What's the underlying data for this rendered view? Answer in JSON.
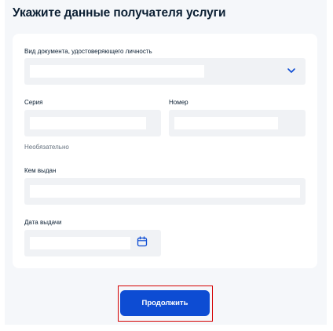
{
  "page": {
    "title": "Укажите данные получателя услуги"
  },
  "form": {
    "document_type": {
      "label": "Вид документа, удостоверяющего личность",
      "value": ""
    },
    "series": {
      "label": "Серия",
      "value": "",
      "hint": "Необязательно"
    },
    "number": {
      "label": "Номер",
      "value": ""
    },
    "issued_by": {
      "label": "Кем выдан",
      "value": ""
    },
    "issue_date": {
      "label": "Дата выдачи",
      "value": ""
    }
  },
  "actions": {
    "continue_label": "Продолжить"
  },
  "icons": {
    "select": "chevron-down-icon",
    "date": "calendar-icon"
  },
  "colors": {
    "primary": "#0d4cd3",
    "highlight_border": "#d50000",
    "text": "#0b1f33",
    "muted": "#66727f",
    "field_bg": "#f0f2f5",
    "page_bg": "#f5f7fa"
  }
}
